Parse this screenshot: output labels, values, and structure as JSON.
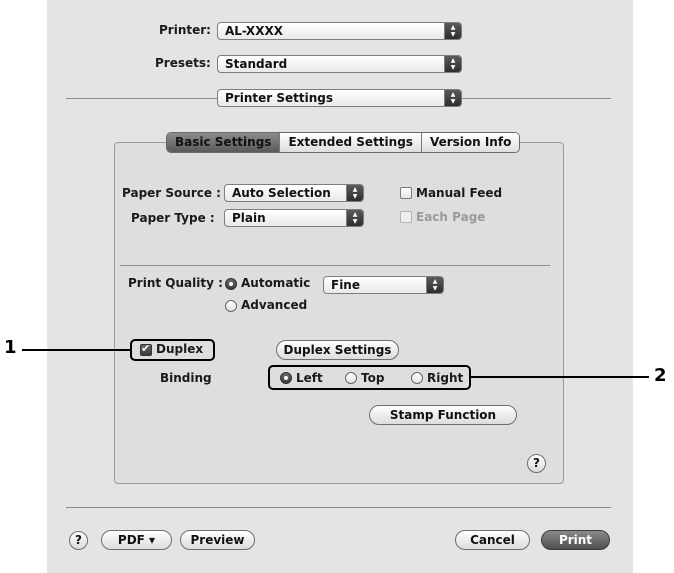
{
  "header": {
    "printer": {
      "label": "Printer:",
      "value": "AL-XXXX"
    },
    "presets": {
      "label": "Presets:",
      "value": "Standard"
    },
    "panel_menu": {
      "value": "Printer Settings"
    }
  },
  "tabs": [
    {
      "label": "Basic Settings",
      "active": true
    },
    {
      "label": "Extended Settings",
      "active": false
    },
    {
      "label": "Version Info",
      "active": false
    }
  ],
  "basic": {
    "paper_source": {
      "label": "Paper Source :",
      "value": "Auto Selection"
    },
    "paper_type": {
      "label": "Paper Type :",
      "value": "Plain"
    },
    "manual_feed": {
      "label": "Manual Feed",
      "checked": false,
      "enabled": true
    },
    "each_page": {
      "label": "Each Page",
      "checked": false,
      "enabled": false
    },
    "print_quality": {
      "label": "Print Quality :",
      "automatic": {
        "label": "Automatic",
        "selected": true
      },
      "advanced": {
        "label": "Advanced",
        "selected": false
      },
      "value": "Fine"
    },
    "duplex": {
      "label": "Duplex",
      "checked": true
    },
    "duplex_settings_label": "Duplex Settings",
    "binding": {
      "label": "Binding",
      "options": [
        {
          "label": "Left",
          "selected": true
        },
        {
          "label": "Top",
          "selected": false
        },
        {
          "label": "Right",
          "selected": false
        }
      ]
    },
    "stamp_function_label": "Stamp Function",
    "help": "?"
  },
  "footer": {
    "help": "?",
    "pdf_label": "PDF ▾",
    "preview_label": "Preview",
    "cancel_label": "Cancel",
    "print_label": "Print"
  },
  "callouts": [
    "1",
    "2"
  ]
}
